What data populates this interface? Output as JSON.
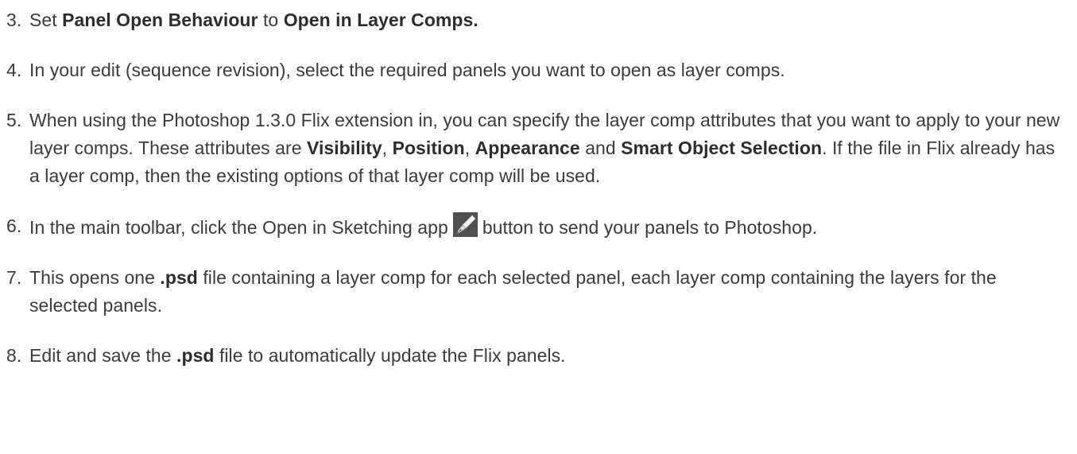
{
  "steps": [
    {
      "number": "3.",
      "segments": [
        "Set ",
        "Panel Open Behaviour",
        " to ",
        "Open in Layer Comps."
      ]
    },
    {
      "number": "4.",
      "text": "In your edit (sequence revision), select the required panels you want to open as layer comps."
    },
    {
      "number": "5.",
      "segments": [
        "When using the Photoshop 1.3.0 Flix extension in, you can specify the layer comp attributes that you want to apply to your new layer comps. These attributes are ",
        "Visibility",
        ", ",
        "Position",
        ", ",
        "Appearance",
        " and ",
        "Smart Object Selection",
        ". If the file in Flix already has a layer comp, then the existing options of that layer comp will be used."
      ]
    },
    {
      "number": "6.",
      "before_icon": "In the main toolbar, click the Open in Sketching app",
      "icon": "pen-nib-icon",
      "after_icon": "button to send your panels to Photoshop."
    },
    {
      "number": "7.",
      "segments": [
        "This opens one ",
        ".psd",
        " file containing a layer comp for each selected panel, each layer comp containing the layers for the selected panels."
      ]
    },
    {
      "number": "8.",
      "segments": [
        "Edit and save the ",
        ".psd",
        " file to automatically update the Flix panels."
      ]
    }
  ]
}
